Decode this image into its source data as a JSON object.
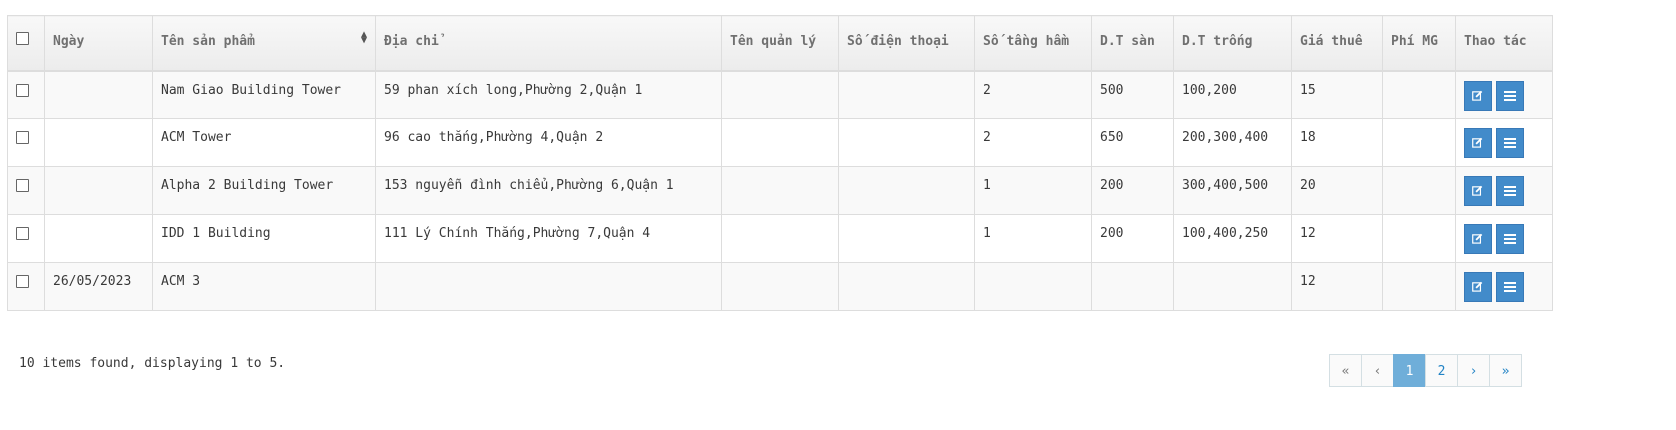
{
  "table": {
    "headers": {
      "date": "Ngày",
      "product": "Tên sản phẩm",
      "address": "Địa chỉ",
      "manager": "Tên quản lý",
      "phone": "Số điện thoại",
      "basements": "Số tầng hầm",
      "floor_area": "D.T sàn",
      "empty_area": "D.T trống",
      "rent": "Giá thuê",
      "fee": "Phí MG",
      "actions": "Thao tác"
    },
    "rows": [
      {
        "date": "",
        "product": "Nam Giao Building Tower",
        "address": "59 phan xích long,Phường 2,Quận 1",
        "manager": "",
        "phone": "",
        "basements": "2",
        "floor_area": "500",
        "empty_area": "100,200",
        "rent": "15",
        "fee": ""
      },
      {
        "date": "",
        "product": "ACM Tower",
        "address": "96 cao thắng,Phường 4,Quận 2",
        "manager": "",
        "phone": "",
        "basements": "2",
        "floor_area": "650",
        "empty_area": "200,300,400",
        "rent": "18",
        "fee": ""
      },
      {
        "date": "",
        "product": "Alpha 2 Building Tower",
        "address": "153 nguyễn đình chiểu,Phường 6,Quận 1",
        "manager": "",
        "phone": "",
        "basements": "1",
        "floor_area": "200",
        "empty_area": "300,400,500",
        "rent": "20",
        "fee": ""
      },
      {
        "date": "",
        "product": "IDD 1 Building",
        "address": "111 Lý Chính Thắng,Phường 7,Quận 4",
        "manager": "",
        "phone": "",
        "basements": "1",
        "floor_area": "200",
        "empty_area": "100,400,250",
        "rent": "12",
        "fee": ""
      },
      {
        "date": "26/05/2023",
        "product": "ACM 3",
        "address": "",
        "manager": "",
        "phone": "",
        "basements": "",
        "floor_area": "",
        "empty_area": "",
        "rent": "12",
        "fee": ""
      }
    ]
  },
  "footer": {
    "summary": "10 items found, displaying 1 to 5."
  },
  "pagination": {
    "first": "«",
    "prev": "‹",
    "pages": [
      "1",
      "2"
    ],
    "current": "1",
    "next": "›",
    "last": "»"
  },
  "icons": {
    "edit": "edit-icon",
    "detail": "list-icon",
    "sort": "sort-icon"
  },
  "colors": {
    "button": "#428bca",
    "active_page": "#6faed9",
    "link": "#2283c5"
  }
}
